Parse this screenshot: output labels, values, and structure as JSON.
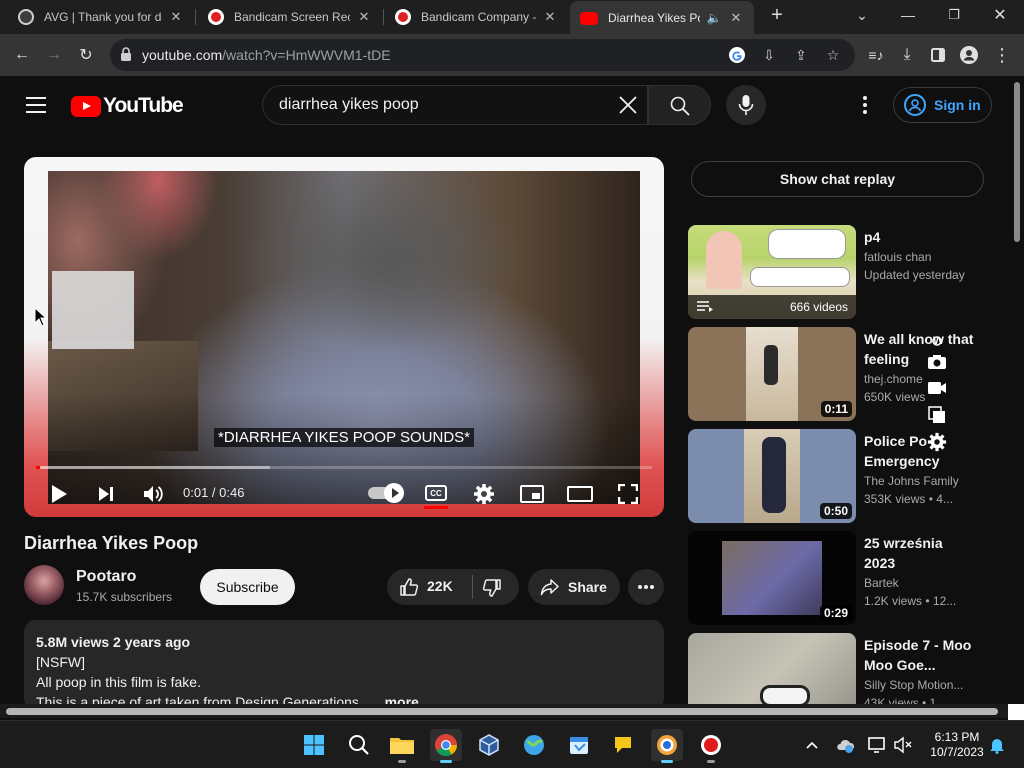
{
  "browser": {
    "tabs": [
      {
        "title": "AVG | Thank you for do",
        "active": false
      },
      {
        "title": "Bandicam Screen Reco",
        "active": false
      },
      {
        "title": "Bandicam Company -",
        "active": false
      },
      {
        "title": "Diarrhea Yikes Poo",
        "active": true
      }
    ],
    "url_host": "youtube.com",
    "url_path": "/watch?v=HmWWVM1-tDE"
  },
  "youtube": {
    "logo_text": "YouTube",
    "search_value": "diarrhea yikes poop",
    "sign_in_label": "Sign in"
  },
  "player": {
    "caption": "*DIARRHEA YIKES POOP SOUNDS*",
    "timecode": "0:01 / 0:46",
    "progress_played": 0.006,
    "progress_buffered": 0.38,
    "cc_label": "CC"
  },
  "video": {
    "title": "Diarrhea Yikes Poop",
    "channel": "Pootaro",
    "subscribers": "15.7K subscribers",
    "subscribe_label": "Subscribe",
    "likes": "22K",
    "share_label": "Share",
    "description": {
      "meta": "5.8M views  2 years ago",
      "lines": [
        "[NSFW]",
        "All poop in this film is fake.",
        "This is a piece of art taken from Design Generations"
      ],
      "more_label": "...more"
    }
  },
  "sidebar": {
    "chat_replay_label": "Show chat replay",
    "recommendations": [
      {
        "title": "p4",
        "channel": "fatlouis chan",
        "meta": "Updated yesterday",
        "badge": "666 videos",
        "is_playlist": true
      },
      {
        "title": "We all know that feeling",
        "channel": "thej.chome",
        "meta": "650K views",
        "badge": "0:11",
        "is_playlist": false
      },
      {
        "title": "Police Po Emergency",
        "channel": "The Johns Family",
        "meta": "353K views  • 4...",
        "badge": "0:50",
        "is_playlist": false
      },
      {
        "title": "25 września 2023",
        "channel": "Bartek",
        "meta": "1.2K views  • 12...",
        "badge": "0:29",
        "is_playlist": false
      },
      {
        "title": "Episode 7 - Moo Moo Goe...",
        "channel": "Silly Stop Motion...",
        "meta": "43K views  • 1...",
        "badge": "",
        "is_playlist": false
      }
    ]
  },
  "taskbar": {
    "time": "6:13 PM",
    "date": "10/7/2023"
  },
  "colors": {
    "yt_red": "#ff0000",
    "link_blue": "#3ea6ff",
    "bg": "#0f0f0f",
    "surface": "#272727"
  }
}
